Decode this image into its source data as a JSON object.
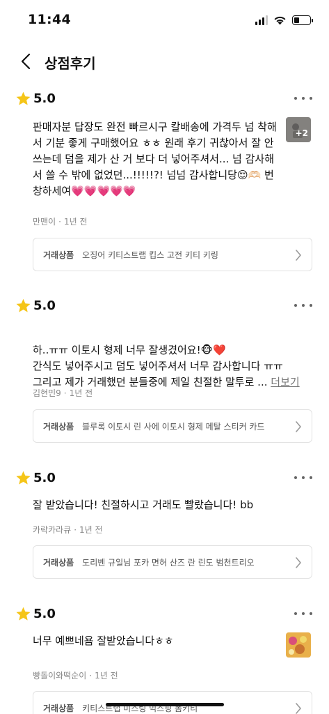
{
  "status": {
    "time": "11:44"
  },
  "header": {
    "title": "상점후기"
  },
  "product_tag": "거래상품",
  "reviews": [
    {
      "rating": "5.0",
      "text": "판매자분 답장도 완전 빠르시구 칼배송에 가격두 넘 착해서 기분 좋게 구매했어요 ㅎㅎ 원래 후기 귀찮아서 잘 안 쓰는데 덤을 제가 산 거 보다 더 넣어주셔서... 넘 감사해서 쓸 수 밖에 없었던...!!!!!?! 넘넘 감사합니당😌🫶🏻 번창하세여💗💗💗💗💗",
      "author": "만맨이",
      "time": "1년 전",
      "product": "오징어 키티스트랩 킵스 고전 키티 키링",
      "photo_count": "+2"
    },
    {
      "rating": "5.0",
      "text": "하..ㅠㅠ 이토시 형제 너무 잘생겼어요!🐵❤️\n간식도 넣어주시고 덤도 넣어주셔서 너무 감사합니다 ㅠㅠ\n그리고 제가 거래했던 분들중에 제일 친절한 말투로 ...",
      "more": "더보기",
      "author": "김현민9",
      "time": "1년 전",
      "product": "블루록 이토시 린 사에 이토시 형제 메탈 스티커 카드"
    },
    {
      "rating": "5.0",
      "text": "잘 받았습니다! 친절하시고 거래도 빨랐습니다! bb",
      "author": "카락카라큐",
      "time": "1년 전",
      "product": "도리벤 규일님 포카 면허 산즈 란 린도 범천트리오"
    },
    {
      "rating": "5.0",
      "text": "너무 예쁘네욤 잘받았습니다ㅎㅎ",
      "author": "빵돌이와떡순이",
      "time": "1년 전",
      "product": "키티스트랩 미스팅 믹스핑 폼키티"
    }
  ],
  "colors": {
    "star": "#F5C518",
    "meta": "#888888",
    "border": "#E2E2E2"
  }
}
